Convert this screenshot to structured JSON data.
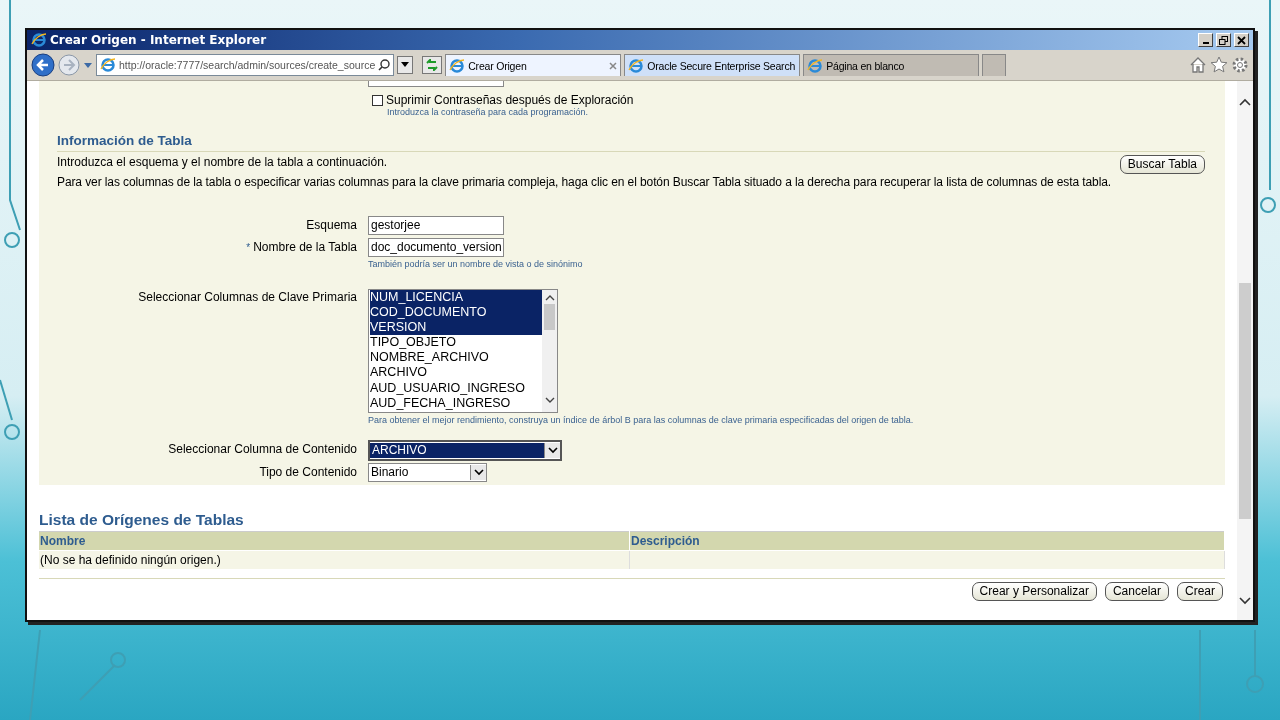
{
  "window": {
    "title": "Crear Origen - Internet Explorer"
  },
  "browser": {
    "address": "http://oracle:7777/search/admin/sources/create_source",
    "tabs": [
      {
        "label": "Crear Origen",
        "selected": true
      },
      {
        "label": "Oracle Secure Enterprise Search",
        "selected": false
      },
      {
        "label": "Página en blanco",
        "selected": false
      }
    ]
  },
  "form": {
    "suppress_passwords": {
      "label": "Suprimir Contraseñas después de Exploración",
      "checked": false,
      "hint": "Introduzca la contraseña para cada programación."
    },
    "section_title": "Información de Tabla",
    "intro": [
      "Introduzca el esquema y el nombre de la tabla a continuación.",
      "Para ver las columnas de la tabla o especificar varias columnas para la clave primaria compleja, haga clic en el botón Buscar Tabla situado a la derecha para recuperar la lista de columnas de esta tabla."
    ],
    "search_button": "Buscar Tabla",
    "fields": [
      {
        "label": "Esquema",
        "value": "gestorjee"
      },
      {
        "label": "Nombre de la Tabla",
        "required_mark": "*",
        "value": "doc_documento_version",
        "hint": "También podría ser un nombre de vista o de sinónimo"
      }
    ],
    "pk_columns": {
      "label": "Seleccionar Columnas de Clave Primaria",
      "hint": "Para obtener el mejor rendimiento, construya un índice de árbol B para las columnas de clave primaria especificadas del origen de tabla.",
      "options": [
        {
          "text": "NUM_LICENCIA",
          "selected": true
        },
        {
          "text": "COD_DOCUMENTO",
          "selected": true
        },
        {
          "text": "VERSION",
          "selected": true
        },
        {
          "text": "TIPO_OBJETO",
          "selected": false
        },
        {
          "text": "NOMBRE_ARCHIVO",
          "selected": false
        },
        {
          "text": "ARCHIVO",
          "selected": false
        },
        {
          "text": "AUD_USUARIO_INGRESO",
          "selected": false
        },
        {
          "text": "AUD_FECHA_INGRESO",
          "selected": false
        }
      ]
    },
    "selects": [
      {
        "label": "Seleccionar Columna de Contenido",
        "value": "ARCHIVO",
        "focused": true,
        "wide": true
      },
      {
        "label": "Tipo de Contenido",
        "value": "Binario",
        "focused": false,
        "wide": false
      }
    ]
  },
  "sources_list": {
    "title": "Lista de Orígenes de Tablas",
    "columns": [
      "Nombre",
      "Descripción"
    ],
    "rows": [
      {
        "nombre": "(No se ha definido ningún origen.)"
      }
    ]
  },
  "buttons": [
    "Crear y Personalizar",
    "Cancelar",
    "Crear"
  ]
}
